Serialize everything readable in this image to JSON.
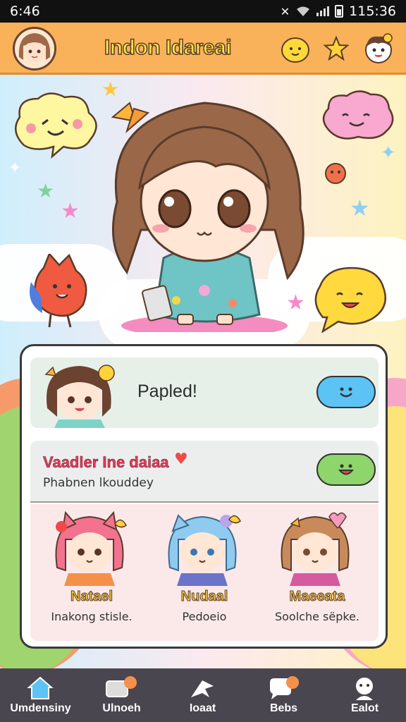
{
  "status_bar": {
    "time": "6:46",
    "clock_right": "115:36"
  },
  "app": {
    "title": "Indon Idareai"
  },
  "header_icons": [
    "smiley-sun-icon",
    "star-icon",
    "mascot-icon"
  ],
  "card": {
    "profile_row": {
      "name": "Papled!",
      "button_icon": "smile-bubble-icon",
      "button_color": "#5cc3f5"
    },
    "status_row": {
      "title": "Vaadler Ine daiaa",
      "subtitle": "Phabnen lkouddey",
      "button_icon": "grin-bubble-icon",
      "button_color": "#8ed56b"
    },
    "friends": [
      {
        "name": "Natael",
        "status": "Inakong stisle.",
        "hair": "#f2728f"
      },
      {
        "name": "Nudaal",
        "status": "Pedoeio",
        "hair": "#8fcbf0"
      },
      {
        "name": "Maeeata",
        "status": "Soolche sëpke.",
        "hair": "#c98a5b"
      }
    ]
  },
  "nav": [
    {
      "label": "Umdensiny",
      "icon": "home-icon"
    },
    {
      "label": "Ulnoeh",
      "icon": "chat-icon"
    },
    {
      "label": "Ioaat",
      "icon": "airplane-icon"
    },
    {
      "label": "Bebs",
      "icon": "message-icon"
    },
    {
      "label": "Ealot",
      "icon": "profile-icon"
    }
  ]
}
